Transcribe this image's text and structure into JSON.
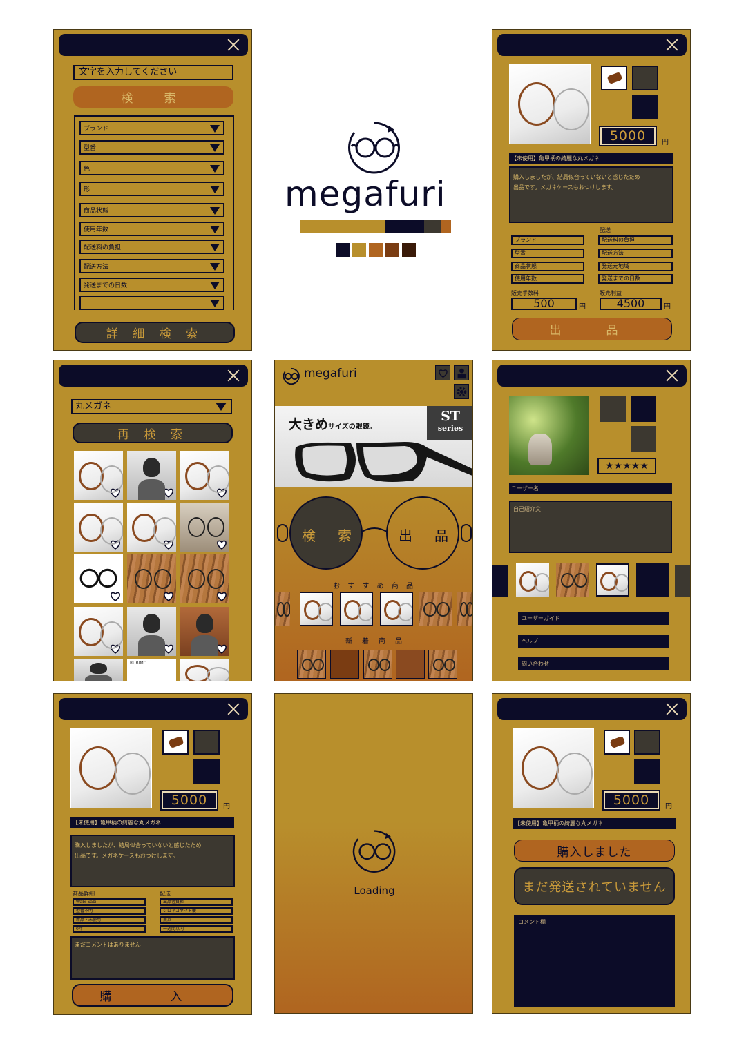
{
  "colors": {
    "gold": "#b88f2c",
    "navy": "#0c0c28",
    "dark": "#3c3830",
    "orange": "#b06520",
    "brown": "#7a3c12",
    "deepbrown": "#3a1a08"
  },
  "logo": {
    "name": "megafuri"
  },
  "search": {
    "placeholder": "文字を入力してください",
    "button": "検　索",
    "filters": [
      "ブランド",
      "型番",
      "色",
      "形",
      "商品状態",
      "使用年数",
      "配送料の負担",
      "配送方法",
      "発送までの日数",
      ""
    ],
    "detail_button": "詳 細 検 索"
  },
  "sell": {
    "price": "5000",
    "yen": "円",
    "title": "【未使用】亀甲柄の綺麗な丸メガネ",
    "desc_line1": "購入しましたが、結局似合っていないと感じたため",
    "desc_line2": "出品です。メガネケースもおつけします。",
    "shipping_label": "配送",
    "left_fields": [
      "ブランド",
      "型番",
      "商品状態",
      "使用年数"
    ],
    "right_fields": [
      "配送料の負担",
      "配送方法",
      "発送元地域",
      "発送までの日数"
    ],
    "fee_label": "販売手数料",
    "fee": "500",
    "profit_label": "販売利益",
    "profit": "4500",
    "submit": "出　品"
  },
  "results": {
    "query": "丸メガネ",
    "research": "再 検 索",
    "partial_label": "RUBIMO"
  },
  "home": {
    "logo": "megafuri",
    "banner_big": "大きめ",
    "banner_small": "サイズの眼鏡。",
    "banner_badge1": "ST",
    "banner_badge2": "series",
    "search_lens": "検　索",
    "sell_lens": "出　品",
    "recommended": "お す す め 商 品",
    "new_arrivals": "新　着　商　品"
  },
  "profile": {
    "stars": "★★★★★",
    "username": "ユーザー名",
    "intro": "自己紹介文",
    "menu": [
      "ユーザーガイド",
      "ヘルプ",
      "問い合わせ"
    ]
  },
  "detail": {
    "price": "5000",
    "yen": "円",
    "title": "【未使用】亀甲柄の綺麗な丸メガネ",
    "desc_line1": "購入しましたが、結局似合っていないと感じたため",
    "desc_line2": "出品です。メガネケースもおつけします。",
    "product_label": "商品詳細",
    "shipping_label": "配送",
    "left_values": [
      "Wabi Sabi",
      "型番不明",
      "新品・未使用",
      "0年"
    ],
    "right_values": [
      "出品者負担",
      "クロネコヤマト便",
      "東京",
      "一週間以内"
    ],
    "no_comments": "まだコメントはありません",
    "buy": "購　入"
  },
  "loading": {
    "text": "Loading"
  },
  "purchased": {
    "price": "5000",
    "yen": "円",
    "title": "【未使用】亀甲柄の綺麗な丸メガネ",
    "status1": "購入しました",
    "status2": "まだ発送されていません",
    "comment": "コメント欄"
  }
}
